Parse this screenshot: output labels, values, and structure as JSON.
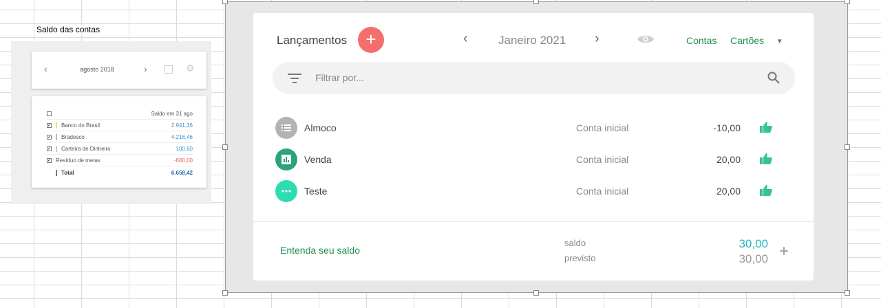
{
  "left": {
    "title": "Saldo das contas",
    "month": "agosto 2018",
    "header": "Saldo em 31 ago",
    "rows": [
      {
        "name": "Banco do Brasil",
        "value": "2.941,36",
        "color": "#f5e06a"
      },
      {
        "name": "Bradesco",
        "value": "4.216,46",
        "color": "#8ec7ef"
      },
      {
        "name": "Carteira de Dinheiro",
        "value": "100,60",
        "color": "#9fe3a6"
      },
      {
        "name": "Resíduo de metas",
        "value": "-600,00",
        "color": ""
      }
    ],
    "total_label": "Total",
    "total_value": "6.658,42"
  },
  "app": {
    "title": "Lançamentos",
    "add": "+",
    "prev": "‹",
    "next": "›",
    "month": "Janeiro 2021",
    "links": {
      "contas": "Contas",
      "cartoes": "Cartões"
    },
    "caret": "▾",
    "search_placeholder": "Filtrar por...",
    "transactions": [
      {
        "name": "Almoco",
        "account": "Conta inicial",
        "amount": "-10,00",
        "icon": "list-icon",
        "color": "#b3b3b3"
      },
      {
        "name": "Venda",
        "account": "Conta inicial",
        "amount": "20,00",
        "icon": "chart-icon",
        "color": "#2aa479"
      },
      {
        "name": "Teste",
        "account": "Conta inicial",
        "amount": "20,00",
        "icon": "more-icon",
        "color": "#2ddcb0"
      }
    ],
    "footer": {
      "link": "Entenda seu saldo",
      "saldo_label": "saldo",
      "previsto_label": "previsto",
      "saldo": "30,00",
      "previsto": "30,00",
      "plus": "+"
    },
    "colors": {
      "accent": "#1e8e4e",
      "add": "#f46e6c",
      "thumb": "#35c590",
      "saldo": "#2bb6c6"
    }
  }
}
